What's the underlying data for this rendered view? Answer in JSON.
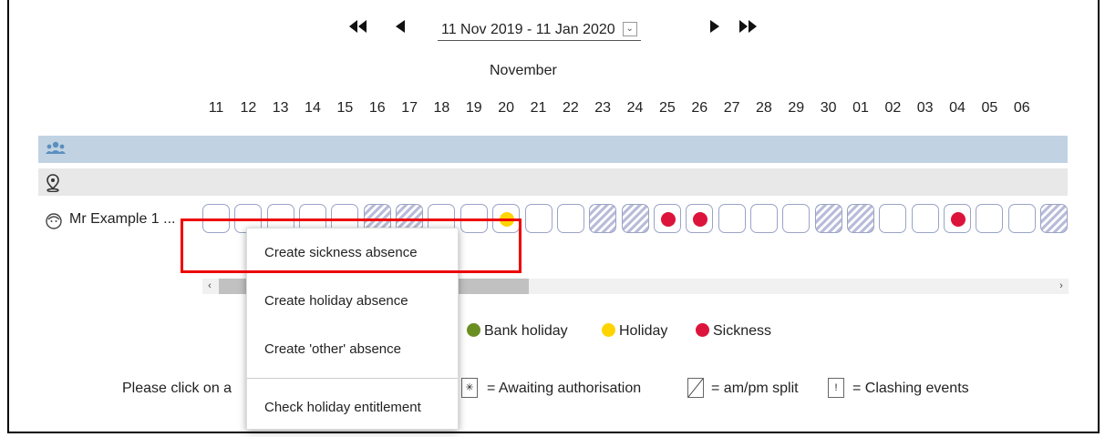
{
  "nav": {
    "first_label": "first",
    "range_label": "11 Nov 2019 - 11 Jan 2020"
  },
  "calendar": {
    "month": "November",
    "days": [
      "11",
      "12",
      "13",
      "14",
      "15",
      "16",
      "17",
      "18",
      "19",
      "20",
      "21",
      "22",
      "23",
      "24",
      "25",
      "26",
      "27",
      "28",
      "29",
      "30",
      "01",
      "02",
      "03",
      "04",
      "05",
      "06"
    ],
    "cells": [
      {
        "type": "empty"
      },
      {
        "type": "empty"
      },
      {
        "type": "empty"
      },
      {
        "type": "empty"
      },
      {
        "type": "empty"
      },
      {
        "type": "weekend"
      },
      {
        "type": "weekend"
      },
      {
        "type": "empty"
      },
      {
        "type": "empty"
      },
      {
        "type": "holiday"
      },
      {
        "type": "empty"
      },
      {
        "type": "empty"
      },
      {
        "type": "weekend"
      },
      {
        "type": "weekend"
      },
      {
        "type": "sickness"
      },
      {
        "type": "sickness"
      },
      {
        "type": "empty"
      },
      {
        "type": "empty"
      },
      {
        "type": "empty"
      },
      {
        "type": "weekend"
      },
      {
        "type": "weekend"
      },
      {
        "type": "empty"
      },
      {
        "type": "empty"
      },
      {
        "type": "sickness"
      },
      {
        "type": "empty"
      },
      {
        "type": "empty"
      },
      {
        "type": "weekend"
      }
    ]
  },
  "person": {
    "name": "Mr Example 1 ..."
  },
  "colors": {
    "team_row": "#c1d3e3",
    "bank_holiday": "#6b8e23",
    "holiday": "#ffd400",
    "sickness": "#dc143c",
    "highlight": "#e00000"
  },
  "legend": {
    "bank_holiday": "Bank holiday",
    "holiday": "Holiday",
    "sickness": "Sickness"
  },
  "info": {
    "prefix": "Please click on a",
    "awaiting": "= Awaiting authorisation",
    "split": "= am/pm split",
    "clashing": "= Clashing events"
  },
  "context_menu": {
    "items": [
      "Create sickness absence",
      "Create holiday absence",
      "Create 'other' absence",
      "Check holiday entitlement"
    ]
  }
}
